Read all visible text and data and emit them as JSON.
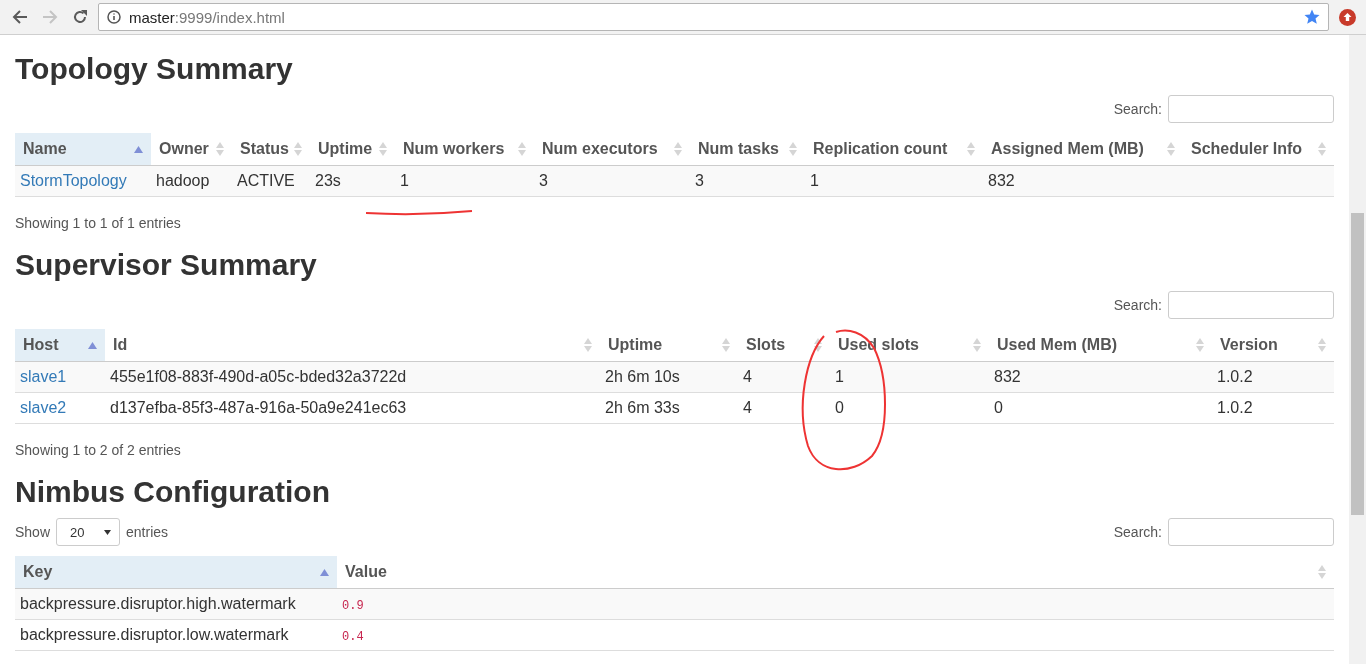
{
  "browser": {
    "nav": [
      {
        "kind": "back",
        "disabled": false
      },
      {
        "kind": "forward",
        "disabled": true
      },
      {
        "kind": "reload",
        "disabled": false
      }
    ],
    "url_host": "master",
    "url_rest": ":9999/index.html"
  },
  "sections": [
    {
      "title": "Topology Summary",
      "search_label": "Search:",
      "columns": [
        {
          "label": "Name",
          "sorted": true,
          "kind": "link"
        },
        {
          "label": "Owner",
          "sorted": false,
          "kind": "text"
        },
        {
          "label": "Status",
          "sorted": false,
          "kind": "text"
        },
        {
          "label": "Uptime",
          "sorted": false,
          "kind": "text"
        },
        {
          "label": "Num workers",
          "sorted": false,
          "kind": "text"
        },
        {
          "label": "Num executors",
          "sorted": false,
          "kind": "text"
        },
        {
          "label": "Num tasks",
          "sorted": false,
          "kind": "text"
        },
        {
          "label": "Replication count",
          "sorted": false,
          "kind": "text"
        },
        {
          "label": "Assigned Mem (MB)",
          "sorted": false,
          "kind": "text"
        },
        {
          "label": "Scheduler Info",
          "sorted": false,
          "kind": "text"
        }
      ],
      "rows": [
        [
          "StormTopology",
          "hadoop",
          "ACTIVE",
          "23s",
          "1",
          "3",
          "3",
          "1",
          "832",
          ""
        ]
      ],
      "info": "Showing 1 to 1 of 1 entries"
    },
    {
      "title": "Supervisor Summary",
      "search_label": "Search:",
      "columns": [
        {
          "label": "Host",
          "sorted": true,
          "kind": "link"
        },
        {
          "label": "Id",
          "sorted": false,
          "kind": "text"
        },
        {
          "label": "Uptime",
          "sorted": false,
          "kind": "text"
        },
        {
          "label": "Slots",
          "sorted": false,
          "kind": "text"
        },
        {
          "label": "Used slots",
          "sorted": false,
          "kind": "text"
        },
        {
          "label": "Used Mem (MB)",
          "sorted": false,
          "kind": "text"
        },
        {
          "label": "Version",
          "sorted": false,
          "kind": "text"
        }
      ],
      "rows": [
        [
          "slave1",
          "455e1f08-883f-490d-a05c-bded32a3722d",
          "2h 6m 10s",
          "4",
          "1",
          "832",
          "1.0.2"
        ],
        [
          "slave2",
          "d137efba-85f3-487a-916a-50a9e241ec63",
          "2h 6m 33s",
          "4",
          "0",
          "0",
          "1.0.2"
        ]
      ],
      "info": "Showing 1 to 2 of 2 entries"
    },
    {
      "title": "Nimbus Configuration",
      "show_label": "Show",
      "show_value": "20",
      "show_suffix": "entries",
      "search_label": "Search:",
      "columns": [
        {
          "label": "Key",
          "sorted": true,
          "kind": "text"
        },
        {
          "label": "Value",
          "sorted": false,
          "kind": "code"
        }
      ],
      "rows": [
        [
          "backpressure.disruptor.high.watermark",
          "0.9"
        ],
        [
          "backpressure.disruptor.low.watermark",
          "0.4"
        ]
      ]
    }
  ]
}
